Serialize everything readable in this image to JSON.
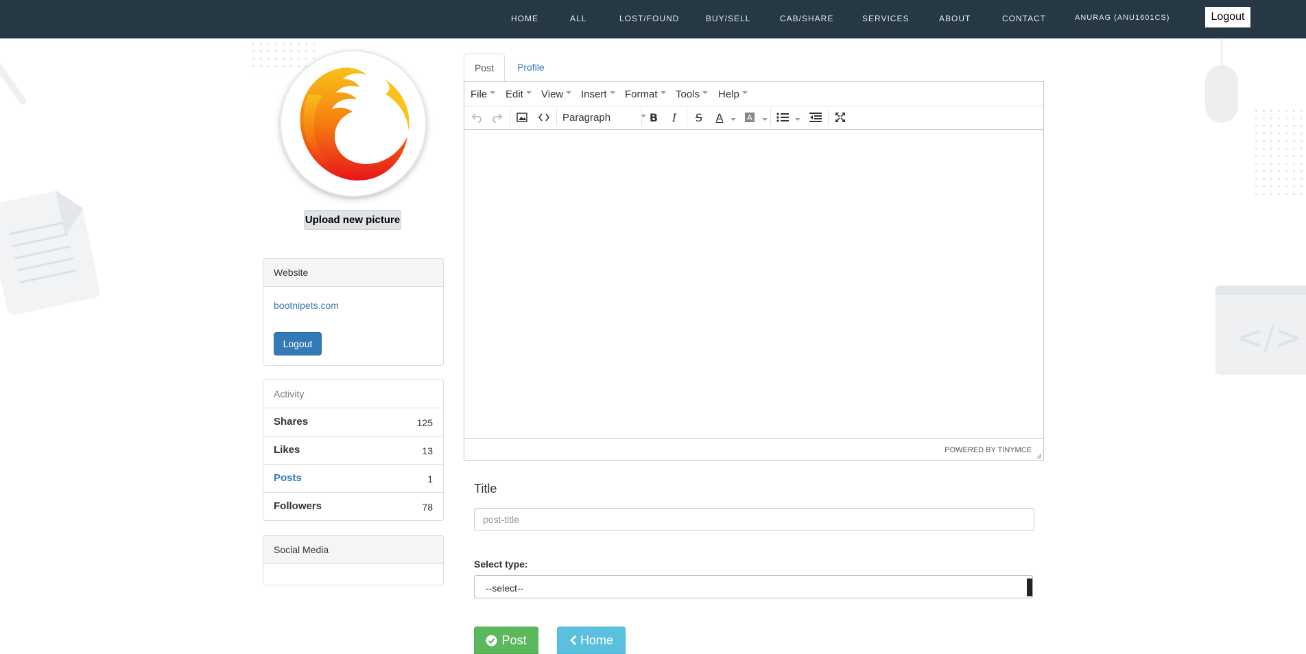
{
  "nav": {
    "items": [
      "HOME",
      "ALL",
      "LOST/FOUND",
      "BUY/SELL",
      "CAB/SHARE",
      "SERVICES",
      "ABOUT",
      "CONTACT"
    ],
    "user": "ANURAG (ANU1601CS)",
    "logout_label": "Logout"
  },
  "sidebar": {
    "upload_label": "Upload new picture",
    "website": {
      "heading": "Website",
      "link": "bootnipets.com",
      "logout_label": "Logout"
    },
    "activity": {
      "heading": "Activity",
      "rows": [
        {
          "label": "Shares",
          "count": "125"
        },
        {
          "label": "Likes",
          "count": "13"
        },
        {
          "label": "Posts",
          "count": "1"
        },
        {
          "label": "Followers",
          "count": "78"
        }
      ]
    },
    "social": {
      "heading": "Social Media"
    }
  },
  "tabs": {
    "post": "Post",
    "profile": "Profile"
  },
  "editor": {
    "menus": [
      "File",
      "Edit",
      "View",
      "Insert",
      "Format",
      "Tools",
      "Help"
    ],
    "format_select": "Paragraph",
    "powered_by": "POWERED BY TINYMCE"
  },
  "form": {
    "title_label": "Title",
    "title_placeholder": "post-title",
    "select_label": "Select type:",
    "select_value": "--select--",
    "post_label": "Post",
    "home_label": "Home"
  },
  "colors": {
    "navbar": "#263844",
    "primary": "#337ab7",
    "success": "#5cb85c",
    "info": "#5bc0de"
  }
}
